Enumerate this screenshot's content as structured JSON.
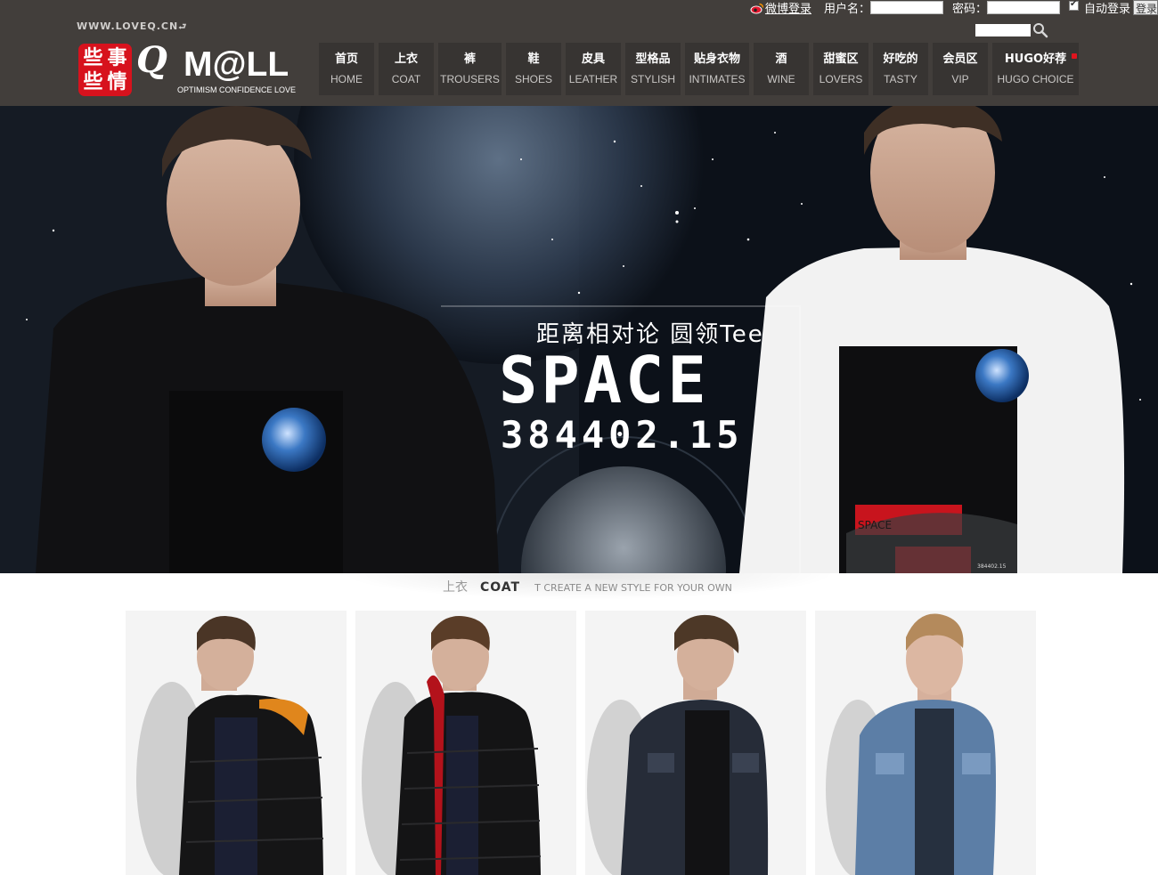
{
  "site": {
    "url_text": "WWW.LOVEQ.CN",
    "logo_seal_chars": [
      "些",
      "事",
      "些",
      "情"
    ],
    "logo_q": "Q",
    "logo_mall": "M@LL",
    "logo_tagline": "OPTIMISM CONFIDENCE LOVE"
  },
  "login": {
    "weibo_label": "微博登录",
    "username_label": "用户名：",
    "password_label": "密码：",
    "remember_label": "自动登录",
    "remember_checked": true,
    "login_button": "登录",
    "username_value": "",
    "password_value": ""
  },
  "search": {
    "value": "",
    "icon": "search-icon"
  },
  "nav": [
    {
      "zh": "首页",
      "en": "HOME"
    },
    {
      "zh": "上衣",
      "en": "COAT"
    },
    {
      "zh": "裤",
      "en": "TROUSERS"
    },
    {
      "zh": "鞋",
      "en": "SHOES"
    },
    {
      "zh": "皮具",
      "en": "LEATHER"
    },
    {
      "zh": "型格品",
      "en": "STYLISH"
    },
    {
      "zh": "贴身衣物",
      "en": "INTIMATES"
    },
    {
      "zh": "酒",
      "en": "WINE"
    },
    {
      "zh": "甜蜜区",
      "en": "LOVERS"
    },
    {
      "zh": "好吃的",
      "en": "TASTY"
    },
    {
      "zh": "会员区",
      "en": "VIP"
    },
    {
      "zh": "HUGO好荐",
      "en": "HUGO CHOICE"
    }
  ],
  "banner": {
    "subtitle": "距离相对论 圆领Tee",
    "title": "SPACE",
    "number": "384402.15",
    "shirt_print_text": "SPACE",
    "shirt_small_text": "384402.15"
  },
  "section": {
    "zh": "上衣",
    "en": "COAT",
    "slogan": "T CREATE A NEW STYLE FOR YOUR OWN"
  },
  "products": [
    {
      "name": "black puffer jacket with orange lining"
    },
    {
      "name": "black puffer jacket with red hood lining"
    },
    {
      "name": "dark denim jacket"
    },
    {
      "name": "light wash denim jacket"
    }
  ],
  "colors": {
    "header_bg": "#423e3b",
    "nav_item_bg": "#373432",
    "brand_red": "#d7121d",
    "banner_bg": "#0c1119"
  }
}
